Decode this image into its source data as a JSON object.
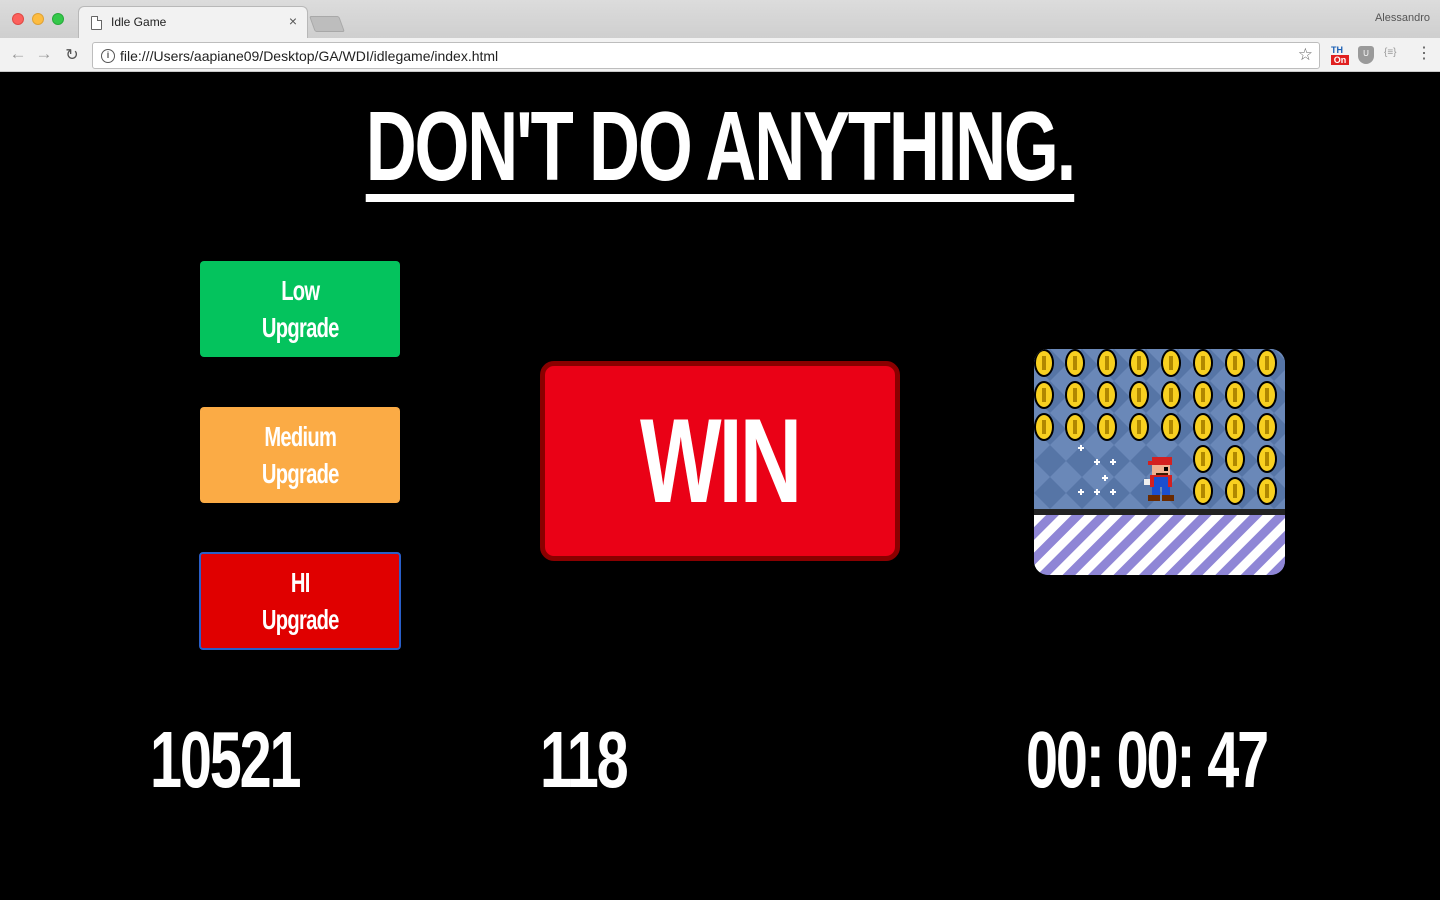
{
  "browser": {
    "tab_title": "Idle Game",
    "tab_close": "×",
    "profile_name": "Alessandro",
    "url": "file:///Users/aapiane09/Desktop/GA/WDI/idlegame/index.html",
    "back": "←",
    "forward": "→",
    "reload": "↻",
    "info": "i",
    "star": "☆",
    "ext_top": "TH",
    "ext_on": "On",
    "ext_shield": "U",
    "ext_code": "{≡}",
    "menu": "⋮"
  },
  "page": {
    "title": "DON'T DO ANYTHING.",
    "upgrades": [
      {
        "label": "Low\nUpgrade",
        "color": "#04c35d"
      },
      {
        "label": "Medium\nUpgrade",
        "color": "#fbab45"
      },
      {
        "label": "HI\nUpgrade",
        "color": "#e00000"
      }
    ],
    "win_label": "WIN",
    "stats": {
      "score": "10521",
      "rate": "118",
      "timer": "00: 00: 47"
    },
    "image_icon": "mario-coins-image"
  },
  "colors": {
    "background": "#000000",
    "win": "#ea0116",
    "win_border": "#8a0000"
  }
}
